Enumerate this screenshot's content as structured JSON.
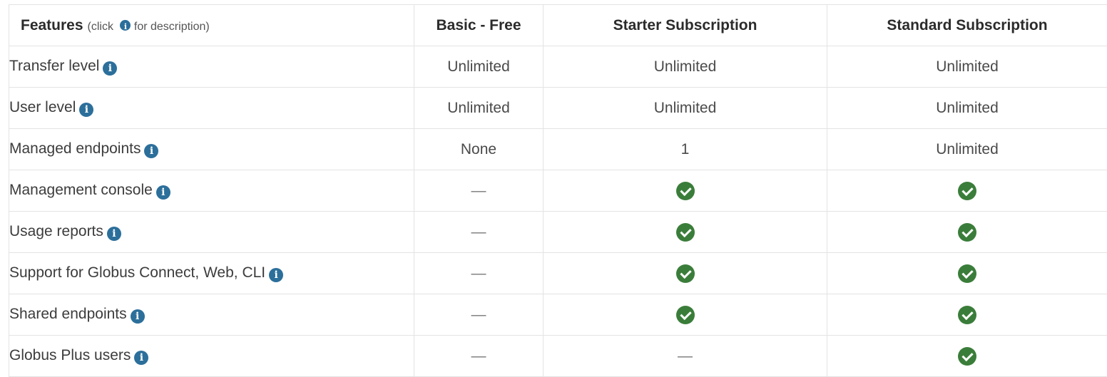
{
  "header": {
    "features_label": "Features",
    "features_hint_pre": "(click",
    "features_hint_post": "for description)",
    "plans": [
      "Basic - Free",
      "Starter Subscription",
      "Standard Subscription"
    ]
  },
  "rows": [
    {
      "feature": "Transfer level",
      "values": [
        "Unlimited",
        "Unlimited",
        "Unlimited"
      ]
    },
    {
      "feature": "User level",
      "values": [
        "Unlimited",
        "Unlimited",
        "Unlimited"
      ]
    },
    {
      "feature": "Managed endpoints",
      "values": [
        "None",
        "1",
        "Unlimited"
      ]
    },
    {
      "feature": "Management console",
      "values": [
        "—",
        "check",
        "check"
      ]
    },
    {
      "feature": "Usage reports",
      "values": [
        "—",
        "check",
        "check"
      ]
    },
    {
      "feature": "Support for Globus Connect, Web, CLI",
      "values": [
        "—",
        "check",
        "check"
      ]
    },
    {
      "feature": "Shared endpoints",
      "values": [
        "—",
        "check",
        "check"
      ]
    },
    {
      "feature": "Globus Plus users",
      "values": [
        "—",
        "—",
        "check"
      ]
    }
  ],
  "icons": {
    "info": "info-icon",
    "available": "check-circle-icon",
    "info_glyph": "i"
  },
  "colors": {
    "info_icon": "#2c6f9b",
    "check_icon": "#3a7d3a",
    "border": "#e3e3e3"
  }
}
